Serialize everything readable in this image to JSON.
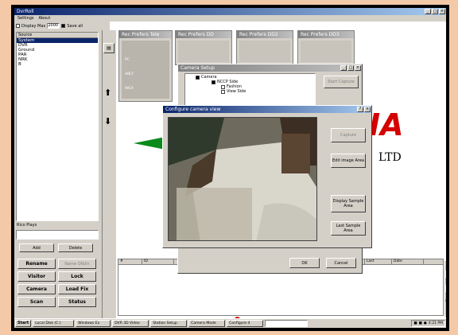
{
  "main_window": {
    "title": "DvrRoll",
    "menu": [
      "Settings",
      "About"
    ],
    "display_max_label": "Display Max",
    "display_max_value": "2000",
    "save_all_label": "Save all"
  },
  "source_list": {
    "header": "Source",
    "items": [
      "System",
      "DVR",
      "Ground",
      "PAR",
      "NRK",
      "B"
    ],
    "selected_index": 0
  },
  "left_panel": {
    "input_label": "Rico Plays",
    "input_value": "",
    "add_label": "Add",
    "delete_label": "Delete",
    "buttons": [
      [
        "Rename",
        "Name Ofd/in"
      ],
      [
        "Visitor",
        "Lock"
      ],
      [
        "Camera",
        "Load Fix"
      ],
      [
        "Scan",
        "Status"
      ]
    ]
  },
  "camera_panels": [
    {
      "title": "Rec Prefers Tele",
      "labels": [
        "PC",
        "ABLT",
        "INCA"
      ]
    },
    {
      "title": "Rec Prefers DD",
      "labels": []
    },
    {
      "title": "Rec Prefers DD2",
      "labels": []
    },
    {
      "title": "Rec Prefers DD3",
      "labels": []
    }
  ],
  "camera_window": {
    "title": "Camera Setup",
    "tree": [
      {
        "label": "Camera",
        "checked": true,
        "indent": 0
      },
      {
        "label": "NCCP Side",
        "checked": true,
        "indent": 1
      },
      {
        "label": "Fashion",
        "checked": false,
        "indent": 2
      },
      {
        "label": "View Side",
        "checked": false,
        "indent": 2
      }
    ],
    "side_button": "Start Capture"
  },
  "video_window": {
    "title": "Configure camera view",
    "buttons": [
      "Capture",
      "Edit image Area",
      "Display Sample Area",
      "Last Sample Area"
    ],
    "ok_label": "OK",
    "cancel_label": "Cancel"
  },
  "logo": {
    "brand_fragment": "IA",
    "sub_fragment": "LTD",
    "accent": "#d50000",
    "arrow_color": "#0a8a1a"
  },
  "grid": {
    "columns": [
      "#",
      "ID",
      "",
      "",
      "",
      "Last",
      "Date"
    ]
  },
  "taskbar": {
    "start_label": "Start",
    "tasks": [
      "Local Disk (C:)",
      "Windows Ex",
      "DVR 3D Video",
      "Station Setup",
      "Camera Mode",
      "Configure d"
    ],
    "clock": "4:21 PM"
  },
  "colors": {
    "frame_bg": "#f4c9a8",
    "title_blue": "#0a246a",
    "face": "#d4d0c8",
    "status_dot": "#e00000"
  }
}
